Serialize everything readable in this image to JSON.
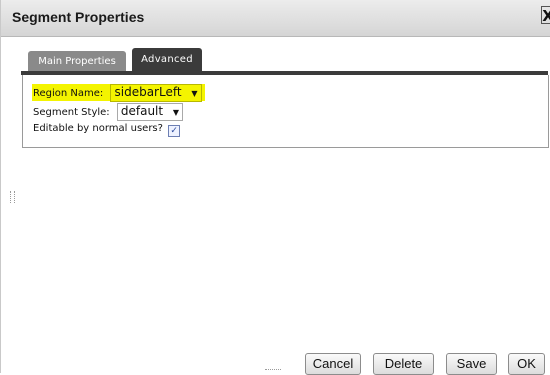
{
  "dialog": {
    "title": "Segment Properties",
    "close_glyph": "X"
  },
  "tabs": [
    {
      "label": "Main Properties",
      "active": false
    },
    {
      "label": "Advanced",
      "active": true
    }
  ],
  "fields": {
    "region": {
      "label": "Region Name:",
      "value": "sidebarLeft"
    },
    "style": {
      "label": "Segment Style:",
      "value": "default"
    },
    "editable": {
      "label": "Editable by normal users?",
      "checked": true,
      "mark": "✓"
    }
  },
  "buttons": {
    "cancel": "Cancel",
    "delete": "Delete",
    "save": "Save",
    "ok": "OK"
  },
  "colors": {
    "highlight": "#f4f400",
    "active_tab": "#3b3b3b",
    "inactive_tab": "#8a8a8a"
  },
  "icons": {
    "dropdown": "chevron-down-icon",
    "close": "close-icon",
    "checkbox": "check-icon"
  }
}
